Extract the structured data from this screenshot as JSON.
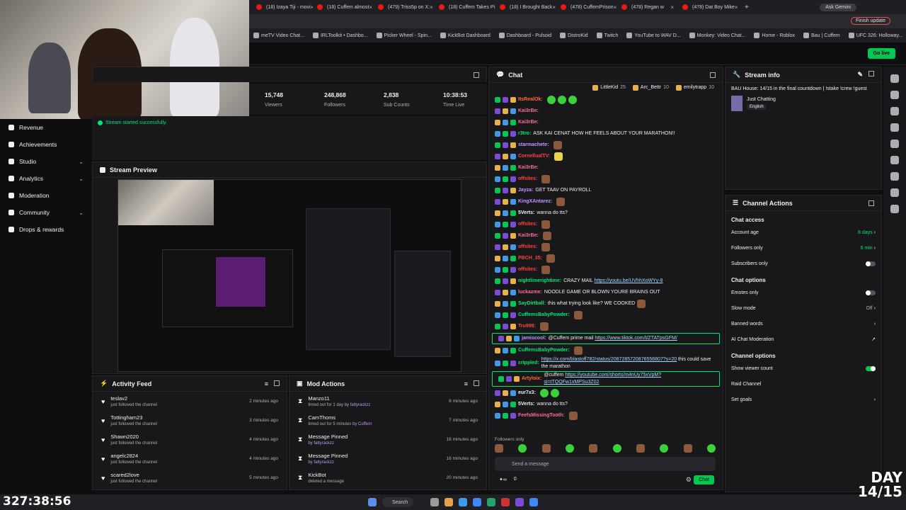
{
  "browser": {
    "tabs": [
      "(18) Izaya Tiji - movi",
      "(18) Cuffem almost",
      "(479) Triss5p on X: ",
      "(18) Cuffem Takes Pi",
      "(18) I Brought Back",
      "(478) CuffemPrison",
      "(478) Regan w",
      "(478) Dat Boy Mike"
    ],
    "ask_gemini": "Ask Gemini",
    "finish_update": "Finish update",
    "bookmarks": [
      "meTV Video Chat...",
      "IRLToolkit • Dashbo...",
      "Picker Wheel - Spin...",
      "KickBot Dashboard",
      "Dashboard - Pulsoid",
      "DistroKid",
      "Twitch",
      "YouTube to WAV D...",
      "Monkey: Video Chat...",
      "Home - Roblox",
      "Bau | Cuffem",
      "UFC 326: Holloway..."
    ],
    "all_bookmarks": "All Bookmarks"
  },
  "header": {
    "go_live": "Go live"
  },
  "sidebar": {
    "items": [
      {
        "label": "Revenue",
        "chevron": false
      },
      {
        "label": "Achievements",
        "chevron": false
      },
      {
        "label": "Studio",
        "chevron": true
      },
      {
        "label": "Analytics",
        "chevron": true
      },
      {
        "label": "Moderation",
        "chevron": false
      },
      {
        "label": "Community",
        "chevron": true
      },
      {
        "label": "Drops & rewards",
        "chevron": false
      }
    ]
  },
  "stats": [
    {
      "value": "15,748",
      "label": "Viewers"
    },
    {
      "value": "248,868",
      "label": "Followers"
    },
    {
      "value": "2,838",
      "label": "Sub Counts"
    },
    {
      "value": "10:38:53",
      "label": "Time Live"
    }
  ],
  "toast": "Stream started successfully.",
  "preview": {
    "title": "Stream Preview"
  },
  "activity": {
    "title": "Activity Feed",
    "items": [
      {
        "name": "teslav2",
        "sub": "just followed the channel",
        "time": "2 minutes ago"
      },
      {
        "name": "Tottingham23",
        "sub": "just followed the channel",
        "time": "3 minutes ago"
      },
      {
        "name": "Shawn2020",
        "sub": "just followed the channel",
        "time": "4 minutes ago"
      },
      {
        "name": "angelc2824",
        "sub": "just followed the channel",
        "time": "4 minutes ago"
      },
      {
        "name": "scared2love",
        "sub": "just followed the channel",
        "time": "5 minutes ago"
      }
    ]
  },
  "mod": {
    "title": "Mod Actions",
    "items": [
      {
        "name": "Manzo11",
        "sub": "timed out for 1 day by ",
        "by": "fattyrackzz",
        "time": "6 minutes ago"
      },
      {
        "name": "CamThoms",
        "sub": "timed out for 5 minutes by ",
        "by": "Cuffem",
        "time": "7 minutes ago"
      },
      {
        "name": "Message Pinned",
        "sub": "by ",
        "by": "fattyrackzz",
        "time": "16 minutes ago"
      },
      {
        "name": "Message Pinned",
        "sub": "by ",
        "by": "fattyrackzz",
        "time": "16 minutes ago"
      },
      {
        "name": "KickBot",
        "sub": "deleted a message",
        "by": "",
        "time": "20 minutes ago"
      }
    ]
  },
  "chat": {
    "title": "Chat",
    "top": [
      {
        "name": "LittleKid",
        "n": "25"
      },
      {
        "name": "Arc_Bettr",
        "n": "10"
      },
      {
        "name": "emilytrapp",
        "n": "10"
      }
    ],
    "messages": [
      {
        "user": "ItsRealOk:",
        "color": "#ff6b3d",
        "text": "",
        "emotes": 3,
        "emote_type": "g"
      },
      {
        "user": "Kai3rBe:",
        "color": "#ff6b9a",
        "text": "",
        "emotes": 0
      },
      {
        "user": "Kai3rBe:",
        "color": "#ff6b9a",
        "text": "",
        "emotes": 0
      },
      {
        "user": "r3tro:",
        "color": "#00e676",
        "text": "ASK KAI CENAT HOW HE FEELS ABOUT YOUR MARATHON!!",
        "emotes": 0
      },
      {
        "user": "starmachete:",
        "color": "#bf94ff",
        "text": "",
        "emotes": 1,
        "emote_type": "b"
      },
      {
        "user": "CornellualTV:",
        "color": "#ff4040",
        "text": "",
        "emotes": 1,
        "emote_type": "y"
      },
      {
        "user": "Kai3rBe:",
        "color": "#ff6b9a",
        "text": "",
        "emotes": 0
      },
      {
        "user": "offsites:",
        "color": "#ff4040",
        "text": "",
        "emotes": 1,
        "emote_type": "b"
      },
      {
        "user": "Jayza:",
        "color": "#bf94ff",
        "text": "GET TAAV ON PAYROLL",
        "emotes": 0
      },
      {
        "user": "KingXAntarez:",
        "color": "#bf94ff",
        "text": "",
        "emotes": 1,
        "emote_type": "b"
      },
      {
        "user": "5Verts:",
        "color": "#efeff1",
        "text": "wanna do tts?",
        "emotes": 0
      },
      {
        "user": "offsites:",
        "color": "#ff4040",
        "text": "",
        "emotes": 1,
        "emote_type": "b"
      },
      {
        "user": "Kai3rBe:",
        "color": "#ff6b9a",
        "text": "",
        "emotes": 1,
        "emote_type": "b"
      },
      {
        "user": "offsites:",
        "color": "#ff4040",
        "text": "",
        "emotes": 1,
        "emote_type": "b"
      },
      {
        "user": "PBCH_35:",
        "color": "#ff4040",
        "text": "",
        "emotes": 1,
        "emote_type": "b"
      },
      {
        "user": "offsites:",
        "color": "#ff4040",
        "text": "",
        "emotes": 1,
        "emote_type": "b"
      },
      {
        "user": "nightlimerightime:",
        "color": "#00e676",
        "text": "CRAZY MAIL ",
        "link": "https://youtu.be/UVhhXoWYy-8",
        "emotes": 0
      },
      {
        "user": "luckazme:",
        "color": "#ff6b9a",
        "text": "NOODLE GAME OR BLOWN YOURE BRAINS OUT",
        "emotes": 0
      },
      {
        "user": "SayDirtball:",
        "color": "#00e676",
        "text": "this what trying look like? WE COOKED",
        "emotes": 1,
        "emote_type": "b"
      },
      {
        "user": "CuffemsBabyPowder:",
        "color": "#00e676",
        "text": "",
        "emotes": 1,
        "emote_type": "b"
      },
      {
        "user": "Tru999:",
        "color": "#ff4040",
        "text": "",
        "emotes": 1,
        "emote_type": "b"
      },
      {
        "user": "jamiscool:",
        "color": "#bf94ff",
        "text": "@Cuffem prime mail ",
        "link": "https://www.tiktok.com/t/ZTATpsGFM/",
        "emotes": 0,
        "highlight": true
      },
      {
        "user": "CuffemsBabyPowder:",
        "color": "#00e676",
        "text": "",
        "emotes": 1,
        "emote_type": "b"
      },
      {
        "user": "crippled:",
        "color": "#00e676",
        "text": "",
        "link": "https://x.com/blastoff782/status/2087285720876556807?s=20",
        "text2": " this could save the marathon",
        "emotes": 0
      },
      {
        "user": "Artyloix:",
        "color": "#ff6b3d",
        "text": "@cuffem ",
        "link": "https://youtube.com/shorts/m4nUy75xVpM?si=ITQQFw1xMPSu3Z02",
        "emotes": 0,
        "highlight": true
      },
      {
        "user": "eur7x3:",
        "color": "#efeff1",
        "text": "",
        "emotes": 2,
        "emote_type": "g"
      },
      {
        "user": "5Verts:",
        "color": "#efeff1",
        "text": "wanna do tts?",
        "emotes": 0
      },
      {
        "user": "FeefsMissingTooth:",
        "color": "#ff6b9a",
        "text": "",
        "emotes": 1,
        "emote_type": "b"
      }
    ],
    "followers_only": "Followers only",
    "input_placeholder": "Send a message",
    "points": "0",
    "send": "Chat"
  },
  "stream_info": {
    "title": "Stream info",
    "stream_title": "BAU House: 14/15 in the final countdown | !stake !crew !guest",
    "category": "Just Chatting",
    "language": "English"
  },
  "channel_actions": {
    "title": "Channel Actions",
    "chat_access": "Chat access",
    "account_age": {
      "label": "Account age",
      "value": "6 days"
    },
    "followers_only": {
      "label": "Followers only",
      "value": "6 min"
    },
    "subscribers_only": {
      "label": "Subscribers only",
      "on": false
    },
    "chat_options": "Chat options",
    "emotes_only": {
      "label": "Emotes only",
      "on": false
    },
    "slow_mode": {
      "label": "Slow mode",
      "value": "Off"
    },
    "banned_words": "Banned words",
    "ai_mod": "AI Chat Moderation",
    "channel_options": "Channel options",
    "show_viewer_count": {
      "label": "Show viewer count",
      "on": true
    },
    "raid_channel": "Raid Channel",
    "set_goals": "Set goals"
  },
  "overlay": {
    "timer": "327:38:56",
    "day_line1": "DAY",
    "day_line2": "14/15"
  },
  "taskbar": {
    "search": "Search"
  },
  "colors": {
    "accent": "#00c853",
    "bg": "#0e0e10",
    "panel": "#18181b"
  }
}
